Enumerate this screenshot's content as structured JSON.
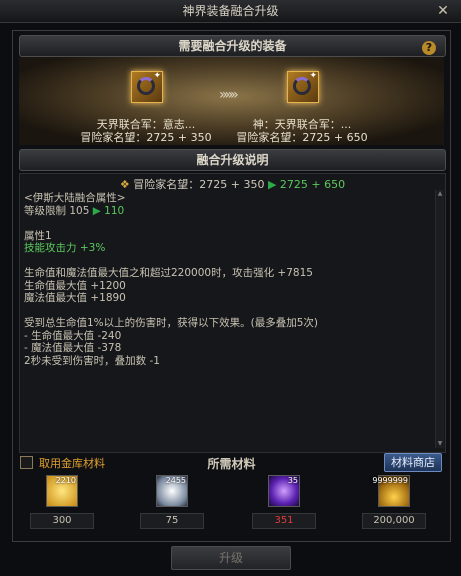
{
  "window": {
    "title": "神界装备融合升级",
    "close_symbol": "✕"
  },
  "section_required": {
    "title": "需要融合升级的装备",
    "help_symbol": "?"
  },
  "equipment": {
    "from": {
      "name": "天界联合军：意志...",
      "fame": "冒险家名望：2725 + 350"
    },
    "arrow": "»»»",
    "to": {
      "name": "神：天界联合军：...",
      "fame": "冒险家名望：2725 + 650"
    }
  },
  "section_desc": {
    "title": "融合升级说明"
  },
  "fame_line": {
    "label": "冒险家名望：2725 + 350",
    "arrow": "▶",
    "new_value": "2725 + 650"
  },
  "desc": {
    "attr_title": "<伊斯大陆融合属性>",
    "level_label": "等级限制 105",
    "level_arrow": "▶",
    "level_new": "110",
    "attr1_title": "属性1",
    "attr1_value": "技能攻击力 +3%",
    "line_hpmp": "生命值和魔法值最大值之和超过220000时，攻击强化 +7815",
    "line_hp": "生命值最大值 +1200",
    "line_mp": "魔法值最大值 +1890",
    "line_dmg": "受到总生命值1%以上的伤害时，获得以下效果。(最多叠加5次)",
    "line_dmg_hp": "- 生命值最大值 -240",
    "line_dmg_mp": "- 魔法值最大值 -378",
    "line_stack": "2秒未受到伤害时，叠加数 -1"
  },
  "materials": {
    "checkbox_label": "取用金库材料",
    "title": "所需材料",
    "shop_button": "材料商店",
    "items": [
      {
        "icon": "yellow-gem-icon",
        "count": "2210",
        "qty": "300",
        "qty_red": false
      },
      {
        "icon": "white-orb-icon",
        "count": "2455",
        "qty": "75",
        "qty_red": false
      },
      {
        "icon": "purple-orb-icon",
        "count": "35",
        "qty": "351",
        "qty_red": true
      },
      {
        "icon": "gold-coins-icon",
        "count": "9999999",
        "qty": "200,000",
        "qty_red": false
      }
    ]
  },
  "upgrade_button": "升级",
  "colors": {
    "green": "#5cc95c",
    "red": "#e23a3a",
    "gold": "#e0a030",
    "shop_blue": "#2b4670"
  }
}
